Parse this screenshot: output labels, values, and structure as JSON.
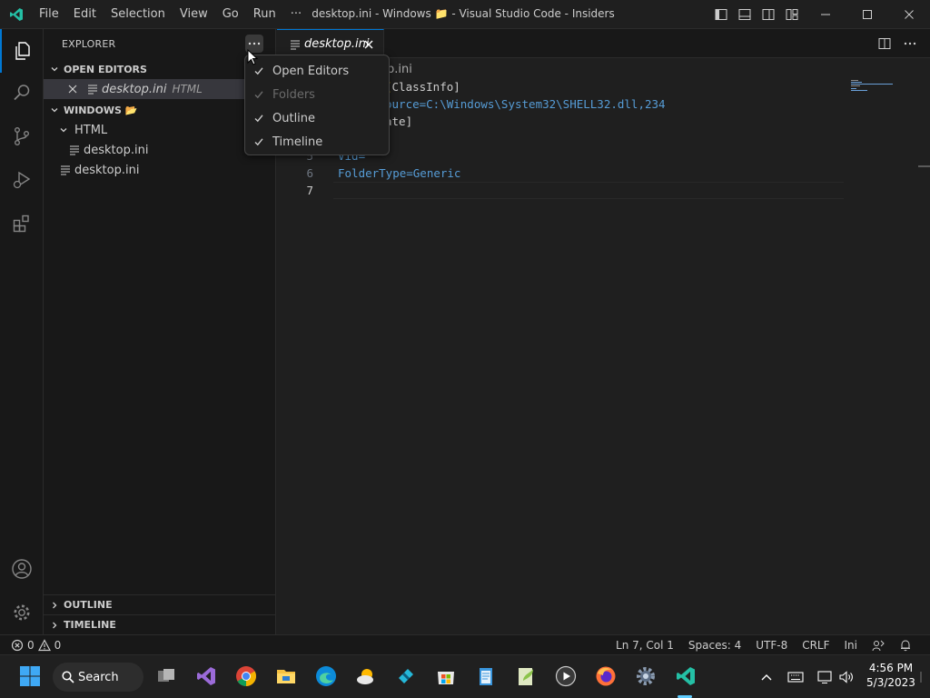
{
  "titlebar": {
    "menu": [
      "File",
      "Edit",
      "Selection",
      "View",
      "Go",
      "Run",
      "···"
    ],
    "title": "desktop.ini - Windows 📁 - Visual Studio Code - Insiders"
  },
  "explorer": {
    "header": "EXPLORER",
    "open_editors": {
      "label": "OPEN EDITORS",
      "items": [
        {
          "name": "desktop.ini",
          "description": "HTML"
        }
      ]
    },
    "folder": {
      "label": "WINDOWS 📂",
      "tree": [
        {
          "name": "HTML",
          "type": "folder"
        },
        {
          "name": "desktop.ini",
          "type": "file"
        },
        {
          "name": "desktop.ini",
          "type": "file"
        }
      ]
    },
    "outline_label": "OUTLINE",
    "timeline_label": "TIMELINE"
  },
  "context_menu": {
    "items": [
      {
        "label": "Open Editors",
        "checked": true,
        "disabled": false
      },
      {
        "label": "Folders",
        "checked": true,
        "disabled": true
      },
      {
        "label": "Outline",
        "checked": true,
        "disabled": false
      },
      {
        "label": "Timeline",
        "checked": true,
        "disabled": false
      }
    ]
  },
  "editor": {
    "tab_label": "desktop.ini",
    "breadcrumb": "p.ini",
    "line_numbers": [
      "5",
      "6",
      "7"
    ],
    "lines": [
      "ClassInfo]",
      "ource=C:\\Windows\\System32\\SHELL32.dll,234",
      "ate]",
      "Vid=",
      "FolderType=Generic"
    ]
  },
  "statusbar": {
    "errors": "0",
    "warnings": "0",
    "position": "Ln 7, Col 1",
    "spaces": "Spaces: 4",
    "encoding": "UTF-8",
    "eol": "CRLF",
    "language": "Ini"
  },
  "taskbar": {
    "search_label": "Search",
    "time": "4:56 PM",
    "date": "5/3/2023"
  },
  "colors": {
    "accent": "#0078d4",
    "keyword": "#569cd6",
    "bracket": "#ffd700",
    "value": "#cccccc"
  }
}
